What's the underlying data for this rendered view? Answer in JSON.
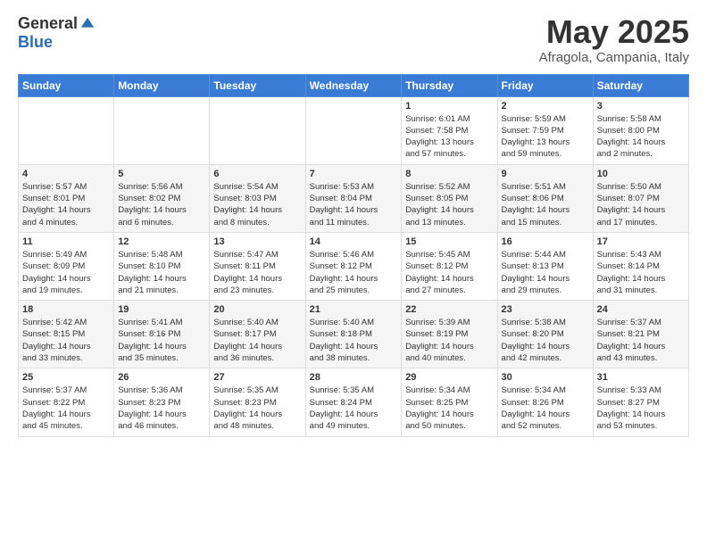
{
  "header": {
    "logo_general": "General",
    "logo_blue": "Blue",
    "month": "May 2025",
    "location": "Afragola, Campania, Italy"
  },
  "days_of_week": [
    "Sunday",
    "Monday",
    "Tuesday",
    "Wednesday",
    "Thursday",
    "Friday",
    "Saturday"
  ],
  "weeks": [
    [
      {
        "day": "",
        "info": ""
      },
      {
        "day": "",
        "info": ""
      },
      {
        "day": "",
        "info": ""
      },
      {
        "day": "",
        "info": ""
      },
      {
        "day": "1",
        "info": "Sunrise: 6:01 AM\nSunset: 7:58 PM\nDaylight: 13 hours\nand 57 minutes."
      },
      {
        "day": "2",
        "info": "Sunrise: 5:59 AM\nSunset: 7:59 PM\nDaylight: 13 hours\nand 59 minutes."
      },
      {
        "day": "3",
        "info": "Sunrise: 5:58 AM\nSunset: 8:00 PM\nDaylight: 14 hours\nand 2 minutes."
      }
    ],
    [
      {
        "day": "4",
        "info": "Sunrise: 5:57 AM\nSunset: 8:01 PM\nDaylight: 14 hours\nand 4 minutes."
      },
      {
        "day": "5",
        "info": "Sunrise: 5:56 AM\nSunset: 8:02 PM\nDaylight: 14 hours\nand 6 minutes."
      },
      {
        "day": "6",
        "info": "Sunrise: 5:54 AM\nSunset: 8:03 PM\nDaylight: 14 hours\nand 8 minutes."
      },
      {
        "day": "7",
        "info": "Sunrise: 5:53 AM\nSunset: 8:04 PM\nDaylight: 14 hours\nand 11 minutes."
      },
      {
        "day": "8",
        "info": "Sunrise: 5:52 AM\nSunset: 8:05 PM\nDaylight: 14 hours\nand 13 minutes."
      },
      {
        "day": "9",
        "info": "Sunrise: 5:51 AM\nSunset: 8:06 PM\nDaylight: 14 hours\nand 15 minutes."
      },
      {
        "day": "10",
        "info": "Sunrise: 5:50 AM\nSunset: 8:07 PM\nDaylight: 14 hours\nand 17 minutes."
      }
    ],
    [
      {
        "day": "11",
        "info": "Sunrise: 5:49 AM\nSunset: 8:09 PM\nDaylight: 14 hours\nand 19 minutes."
      },
      {
        "day": "12",
        "info": "Sunrise: 5:48 AM\nSunset: 8:10 PM\nDaylight: 14 hours\nand 21 minutes."
      },
      {
        "day": "13",
        "info": "Sunrise: 5:47 AM\nSunset: 8:11 PM\nDaylight: 14 hours\nand 23 minutes."
      },
      {
        "day": "14",
        "info": "Sunrise: 5:46 AM\nSunset: 8:12 PM\nDaylight: 14 hours\nand 25 minutes."
      },
      {
        "day": "15",
        "info": "Sunrise: 5:45 AM\nSunset: 8:12 PM\nDaylight: 14 hours\nand 27 minutes."
      },
      {
        "day": "16",
        "info": "Sunrise: 5:44 AM\nSunset: 8:13 PM\nDaylight: 14 hours\nand 29 minutes."
      },
      {
        "day": "17",
        "info": "Sunrise: 5:43 AM\nSunset: 8:14 PM\nDaylight: 14 hours\nand 31 minutes."
      }
    ],
    [
      {
        "day": "18",
        "info": "Sunrise: 5:42 AM\nSunset: 8:15 PM\nDaylight: 14 hours\nand 33 minutes."
      },
      {
        "day": "19",
        "info": "Sunrise: 5:41 AM\nSunset: 8:16 PM\nDaylight: 14 hours\nand 35 minutes."
      },
      {
        "day": "20",
        "info": "Sunrise: 5:40 AM\nSunset: 8:17 PM\nDaylight: 14 hours\nand 36 minutes."
      },
      {
        "day": "21",
        "info": "Sunrise: 5:40 AM\nSunset: 8:18 PM\nDaylight: 14 hours\nand 38 minutes."
      },
      {
        "day": "22",
        "info": "Sunrise: 5:39 AM\nSunset: 8:19 PM\nDaylight: 14 hours\nand 40 minutes."
      },
      {
        "day": "23",
        "info": "Sunrise: 5:38 AM\nSunset: 8:20 PM\nDaylight: 14 hours\nand 42 minutes."
      },
      {
        "day": "24",
        "info": "Sunrise: 5:37 AM\nSunset: 8:21 PM\nDaylight: 14 hours\nand 43 minutes."
      }
    ],
    [
      {
        "day": "25",
        "info": "Sunrise: 5:37 AM\nSunset: 8:22 PM\nDaylight: 14 hours\nand 45 minutes."
      },
      {
        "day": "26",
        "info": "Sunrise: 5:36 AM\nSunset: 8:23 PM\nDaylight: 14 hours\nand 46 minutes."
      },
      {
        "day": "27",
        "info": "Sunrise: 5:35 AM\nSunset: 8:23 PM\nDaylight: 14 hours\nand 48 minutes."
      },
      {
        "day": "28",
        "info": "Sunrise: 5:35 AM\nSunset: 8:24 PM\nDaylight: 14 hours\nand 49 minutes."
      },
      {
        "day": "29",
        "info": "Sunrise: 5:34 AM\nSunset: 8:25 PM\nDaylight: 14 hours\nand 50 minutes."
      },
      {
        "day": "30",
        "info": "Sunrise: 5:34 AM\nSunset: 8:26 PM\nDaylight: 14 hours\nand 52 minutes."
      },
      {
        "day": "31",
        "info": "Sunrise: 5:33 AM\nSunset: 8:27 PM\nDaylight: 14 hours\nand 53 minutes."
      }
    ]
  ]
}
